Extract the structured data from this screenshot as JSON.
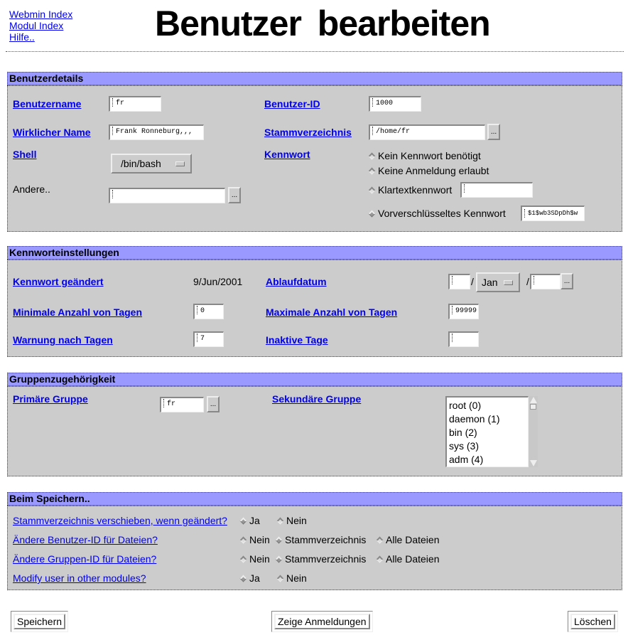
{
  "top_links": [
    "Webmin Index",
    "Modul Index",
    "Hilfe.."
  ],
  "page_title": "Benutzer bearbeiten",
  "colors": {
    "section_header": "#9999ff",
    "section_body": "#cccccc",
    "link": "#0000ee"
  },
  "user_details": {
    "header": "Benutzerdetails",
    "username": {
      "label": "Benutzername",
      "value": "fr"
    },
    "user_id": {
      "label": "Benutzer-ID",
      "value": "1000"
    },
    "real_name": {
      "label": "Wirklicher Name",
      "value": "Frank Ronneburg,,,"
    },
    "home_dir": {
      "label": "Stammverzeichnis",
      "value": "/home/fr",
      "browse": "..."
    },
    "shell": {
      "label": "Shell",
      "selected": "/bin/bash"
    },
    "other_shell": {
      "label": "Andere..",
      "value": "",
      "browse": "..."
    },
    "password": {
      "label": "Kennwort",
      "options": [
        {
          "label": "Kein Kennwort benötigt",
          "selected": false
        },
        {
          "label": "Keine Anmeldung erlaubt",
          "selected": false
        },
        {
          "label": "Klartextkennwort",
          "selected": false,
          "value": ""
        },
        {
          "label": "Vorverschlüsseltes Kennwort",
          "selected": true,
          "value": "$1$wb3SDpDh$w"
        }
      ]
    }
  },
  "password_settings": {
    "header": "Kennworteinstellungen",
    "changed": {
      "label": "Kennwort geändert",
      "value": "9/Jun/2001"
    },
    "expiry": {
      "label": "Ablaufdatum",
      "day": "",
      "month": "Jan",
      "year": "",
      "sep": "/",
      "browse": "..."
    },
    "min_days": {
      "label": "Minimale Anzahl von Tagen",
      "value": "0"
    },
    "max_days": {
      "label": "Maximale Anzahl von Tagen",
      "value": "99999"
    },
    "warn_days": {
      "label": "Warnung nach Tagen",
      "value": "7"
    },
    "inactive_days": {
      "label": "Inaktive Tage",
      "value": ""
    }
  },
  "groups": {
    "header": "Gruppenzugehörigkeit",
    "primary": {
      "label": "Primäre Gruppe",
      "value": "fr",
      "browse": "..."
    },
    "secondary": {
      "label": "Sekundäre Gruppe",
      "items": [
        "root (0)",
        "daemon (1)",
        "bin (2)",
        "sys (3)",
        "adm (4)"
      ]
    }
  },
  "on_save": {
    "header": "Beim Speichern..",
    "rows": [
      {
        "label": "Stammverzeichnis verschieben, wenn geändert?",
        "options": [
          {
            "label": "Ja",
            "selected": true
          },
          {
            "label": "Nein",
            "selected": false
          }
        ]
      },
      {
        "label": "Ändere Benutzer-ID für Dateien?",
        "options": [
          {
            "label": "Nein",
            "selected": false
          },
          {
            "label": "Stammverzeichnis",
            "selected": true
          },
          {
            "label": "Alle Dateien",
            "selected": false
          }
        ]
      },
      {
        "label": "Ändere Gruppen-ID für Dateien?",
        "options": [
          {
            "label": "Nein",
            "selected": false
          },
          {
            "label": "Stammverzeichnis",
            "selected": true
          },
          {
            "label": "Alle Dateien",
            "selected": false
          }
        ]
      },
      {
        "label": "Modify user in other modules?",
        "options": [
          {
            "label": "Ja",
            "selected": true
          },
          {
            "label": "Nein",
            "selected": false
          }
        ]
      }
    ]
  },
  "buttons": {
    "save": "Speichern",
    "show_logins": "Zeige Anmeldungen",
    "delete": "Löschen"
  }
}
